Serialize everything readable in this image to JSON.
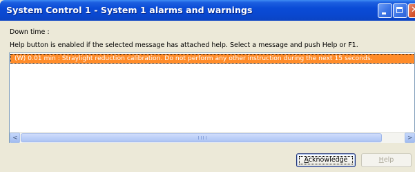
{
  "window": {
    "title": "System Control 1 - System 1 alarms and warnings"
  },
  "labels": {
    "down_time": "Down time :",
    "help_info": "Help button is enabled if the selected message has attached help. Select a message and push Help or F1."
  },
  "messages": [
    {
      "text": "(W)    0.01 min : Straylight reduction calibration. Do not perform any other instruction during the next 15 seconds.",
      "selected": true
    }
  ],
  "scrollbar": {
    "left_arrow": "<",
    "right_arrow": ">"
  },
  "buttons": {
    "acknowledge_first": "A",
    "acknowledge_rest": "cknowledge",
    "help_first": "H",
    "help_rest": "elp"
  },
  "colors": {
    "selection": "#ff8c2a",
    "titlebar": "#0a48d0"
  }
}
